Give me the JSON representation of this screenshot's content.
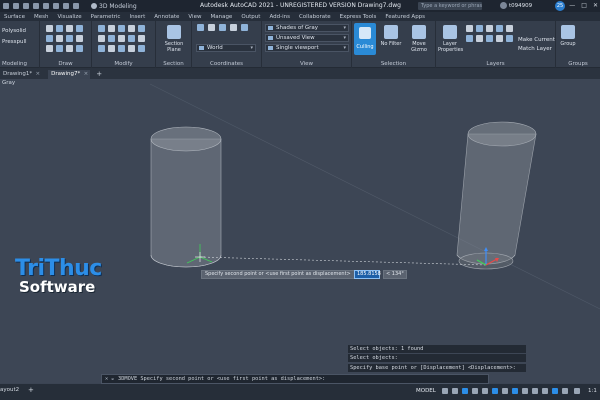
{
  "titlebar": {
    "workspace": "3D Modeling",
    "title": "Autodesk AutoCAD 2021 - UNREGISTERED VERSION   Drawing7.dwg",
    "search_placeholder": "Type a keyword or phrase",
    "user": "t094909",
    "badge": "25",
    "win_min": "—",
    "win_max": "□",
    "win_close": "✕"
  },
  "ribbon_tabs": [
    "Surface",
    "Mesh",
    "Visualize",
    "Parametric",
    "Insert",
    "Annotate",
    "View",
    "Manage",
    "Output",
    "Add-ins",
    "Collaborate",
    "Express Tools",
    "Featured Apps"
  ],
  "ribbon": {
    "modeling": {
      "polysolid": "Polysolid",
      "presspull": "Presspull",
      "label": "Modeling"
    },
    "draw_label": "Draw",
    "modify_label": "Modify",
    "section": {
      "plane": "Section\nPlane",
      "label": "Section"
    },
    "coordinates": {
      "world": "World",
      "label": "Coordinates"
    },
    "view": {
      "visual_style": "Shades of Gray",
      "saved_view": "Unsaved View",
      "viewport": "Single viewport",
      "label": "View"
    },
    "selection": {
      "culling": "Culling",
      "no_filter": "No Filter",
      "move_gizmo": "Move\nGizmo",
      "label": "Selection"
    },
    "layers": {
      "layer_props": "Layer\nProperties",
      "make_current": "Make Current",
      "match_layer": "Match Layer",
      "label": "Layers"
    },
    "groups": {
      "group": "Group",
      "label": "Groups"
    }
  },
  "doc_tabs": [
    {
      "label": "Drawing1*",
      "active": false
    },
    {
      "label": "Drawing7*",
      "active": true
    }
  ],
  "viewport": {
    "style_label": "Gray",
    "tooltip": "Specify second point or <use first point as displacement>",
    "distance_value": "185.8158",
    "angle_value": "< 134°"
  },
  "command_history": [
    "Select objects: 1 found",
    "Select objects:",
    "Specify base point or [Displacement] <Displacement>:"
  ],
  "command_line": {
    "icons": "✕ 𝄪",
    "prompt": "3DMOVE Specify second point or <use first point as displacement>:"
  },
  "logo": {
    "line1": "TriThuc",
    "line2": "Software"
  },
  "status_bar": {
    "layout_tab": "ayout2",
    "add": "+",
    "model": "MODEL",
    "scale": "1:1"
  },
  "colors": {
    "accent": "#2a8ad6",
    "viewport_bg": "#3d4655",
    "logo_blue": "#2c8ee8"
  }
}
